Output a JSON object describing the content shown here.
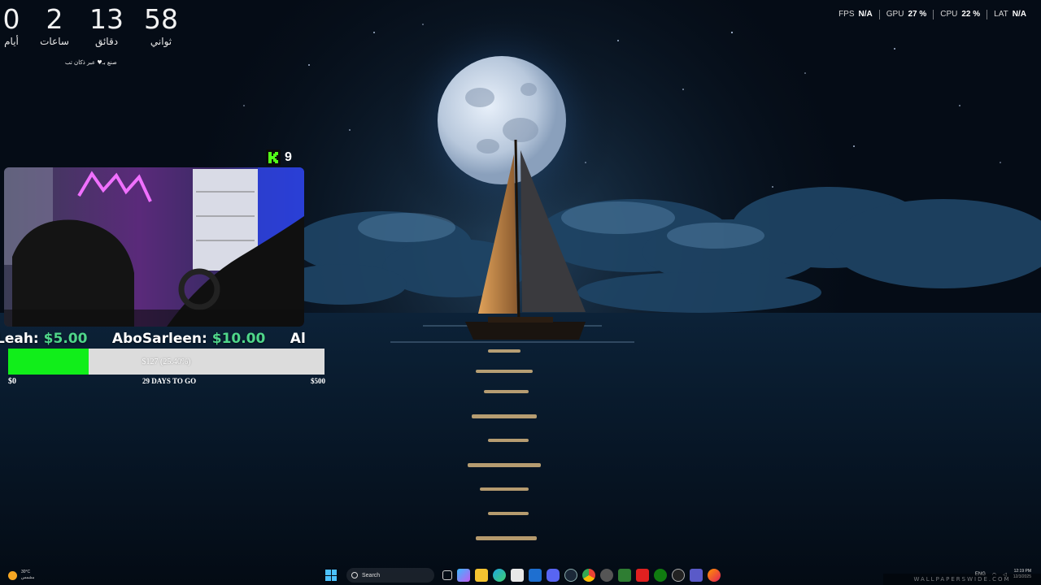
{
  "countdown": {
    "days": "0",
    "days_label": "أيام",
    "hours": "2",
    "hours_label": "ساعات",
    "minutes": "13",
    "minutes_label": "دقائق",
    "seconds": "58",
    "seconds_label": "ثواني",
    "credit": "صنع بـ♥ عبر ذكان تب"
  },
  "perf": {
    "fps_label": "FPS",
    "fps_value": "N/A",
    "gpu_label": "GPU",
    "gpu_value": "27 %",
    "cpu_label": "CPU",
    "cpu_value": "22 %",
    "lat_label": "LAT",
    "lat_value": "N/A"
  },
  "stream": {
    "viewer_count": "9",
    "platform_icon": "kick-logo-icon",
    "accent": "#53fc18"
  },
  "donations": [
    {
      "name": "Leah:",
      "amount": "$5.00"
    },
    {
      "name": "AboSarleen:",
      "amount": "$10.00"
    },
    {
      "name": "Al",
      "amount": ""
    }
  ],
  "goal": {
    "progress_text": "$127 (25.40%)",
    "progress_fraction": 0.254,
    "min_label": "$0",
    "days_label": "29 DAYS TO GO",
    "max_label": "$500",
    "fill_color": "#11ee1a"
  },
  "taskbar": {
    "weather_temp": "30°C",
    "weather_desc": "مشمس",
    "search_placeholder": "Search",
    "lang": "ENG",
    "time": "12:19 PM",
    "date": "12/3/2025",
    "watermark": "WALLPAPERSWIDE.COM"
  }
}
